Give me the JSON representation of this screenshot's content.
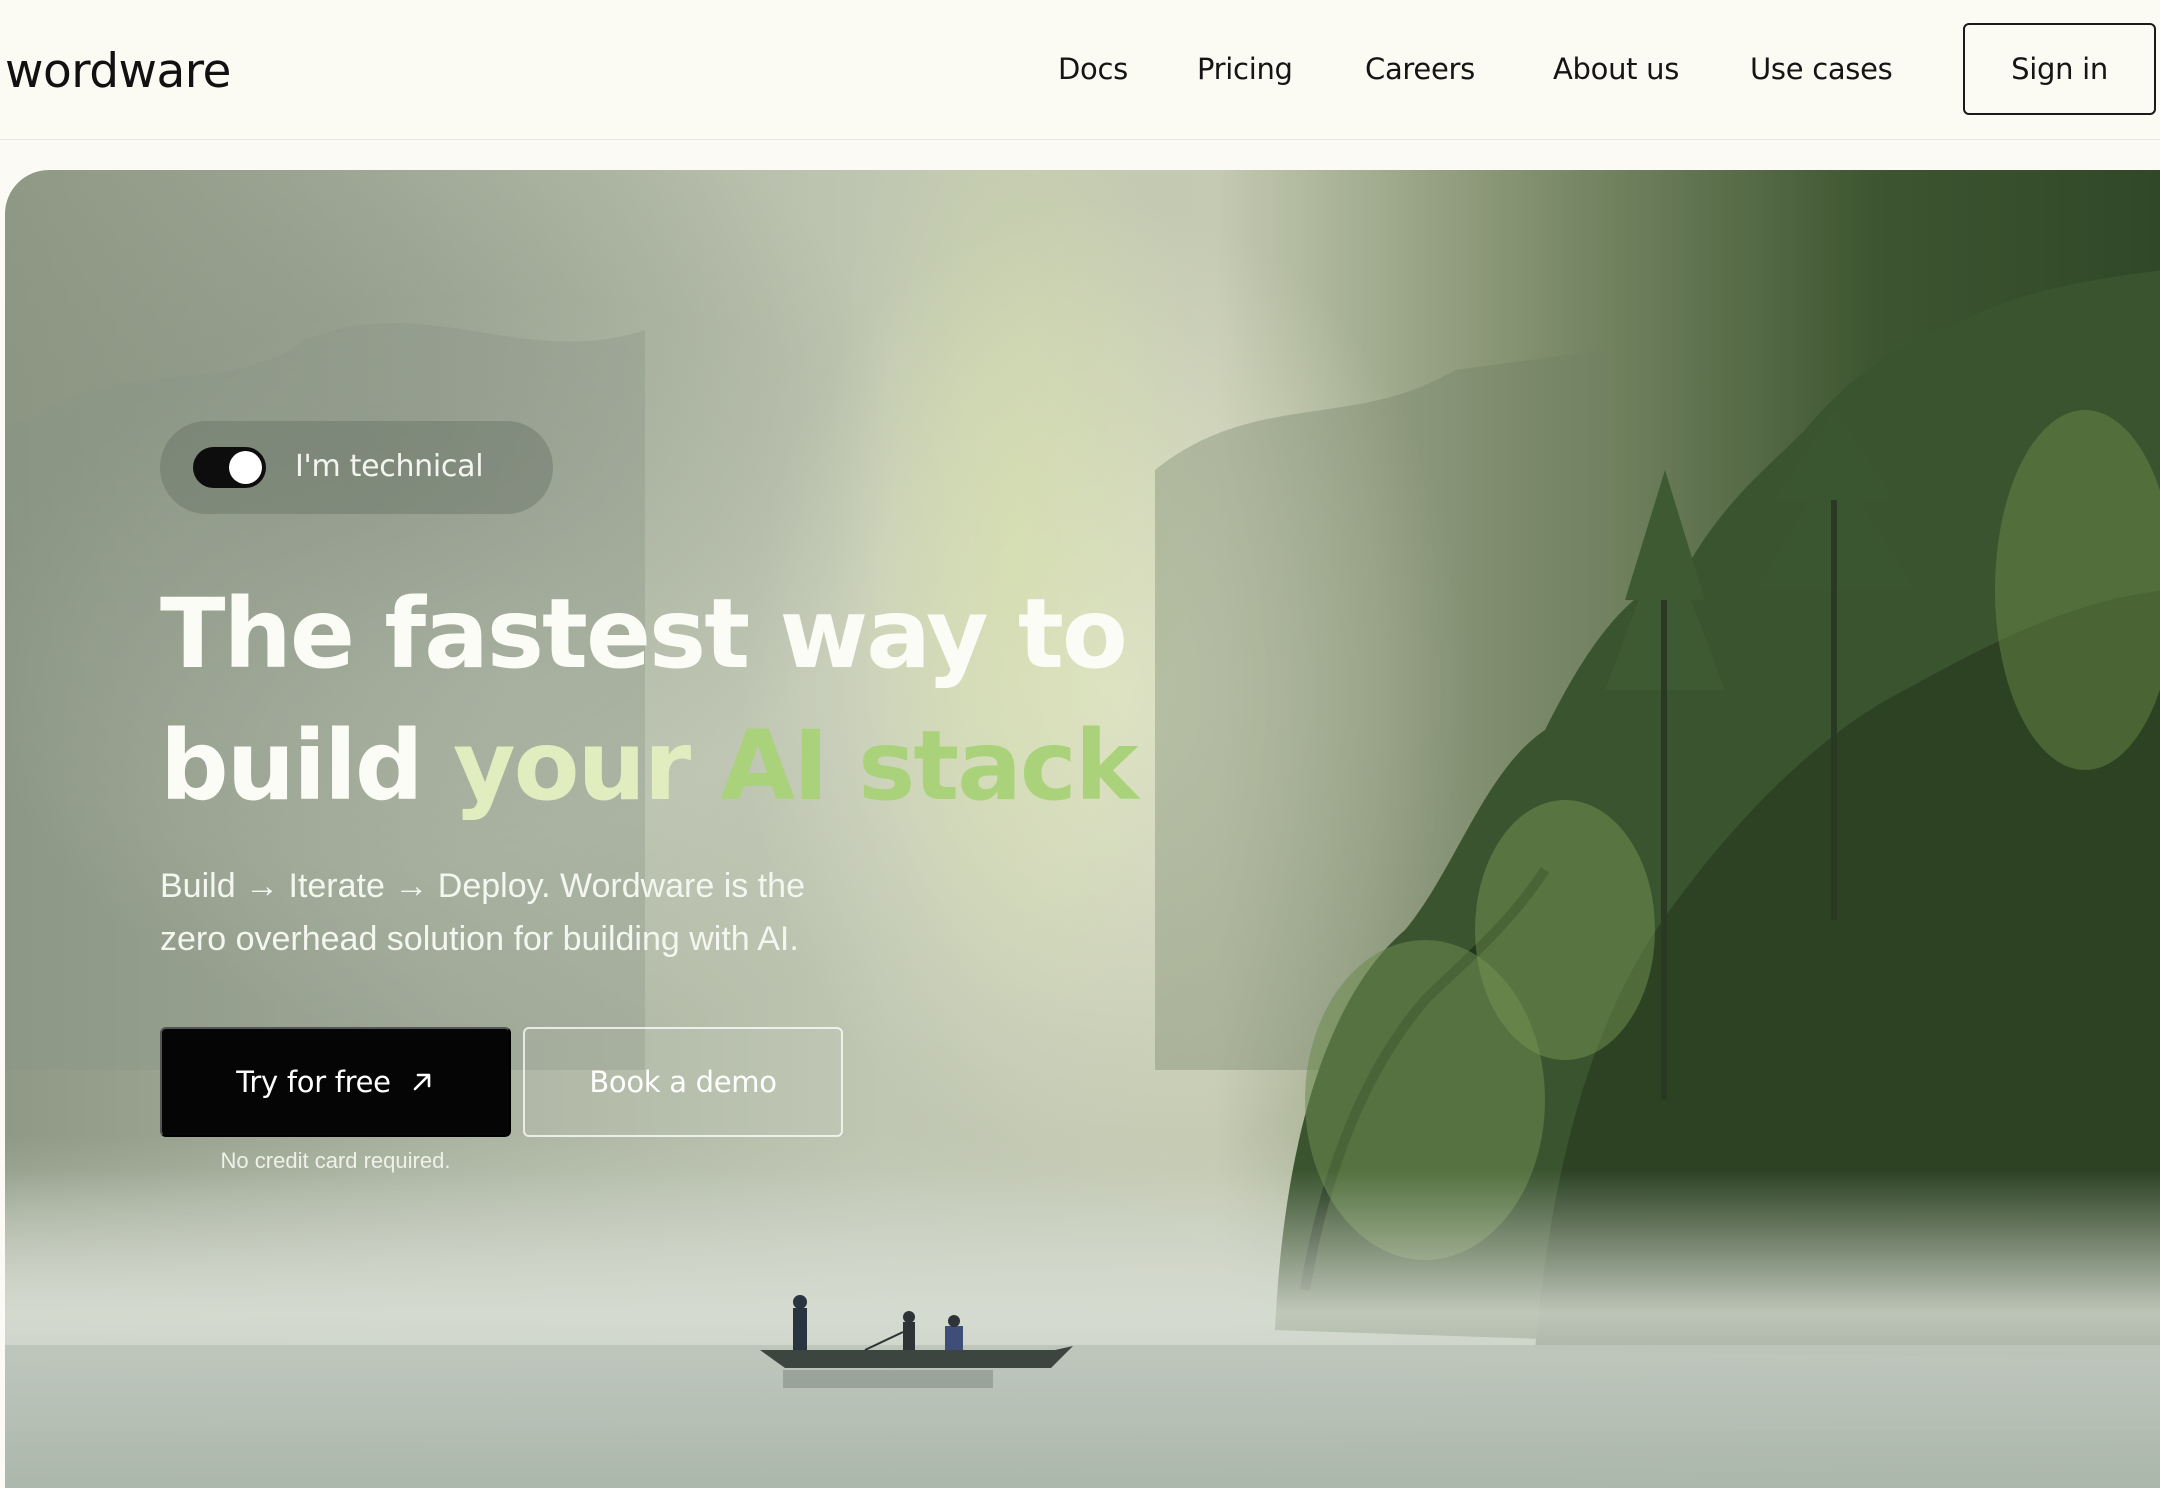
{
  "header": {
    "logo": "wordware",
    "nav": [
      {
        "label": "Docs"
      },
      {
        "label": "Pricing"
      },
      {
        "label": "Careers"
      },
      {
        "label": "About us"
      },
      {
        "label": "Use cases"
      }
    ],
    "sign_in_label": "Sign in"
  },
  "hero": {
    "toggle": {
      "label": "I'm technical",
      "on": true
    },
    "headline": {
      "line1": "The fastest way to",
      "line2_plain": "build ",
      "line2_accent_1": "your ",
      "line2_accent_2": "AI stack"
    },
    "subtext": {
      "line1": "Build → Iterate → Deploy. Wordware is the",
      "line2": "zero overhead solution for building with AI."
    },
    "primary_cta": {
      "label": "Try for free",
      "icon": "arrow-up-right-icon"
    },
    "secondary_cta": {
      "label": "Book a demo"
    },
    "note": "No credit card required."
  },
  "colors": {
    "background": "#fbfaf4",
    "primary_button": "#050505",
    "accent_light": "#e1ecbf",
    "accent_green": "#a9d27a"
  }
}
